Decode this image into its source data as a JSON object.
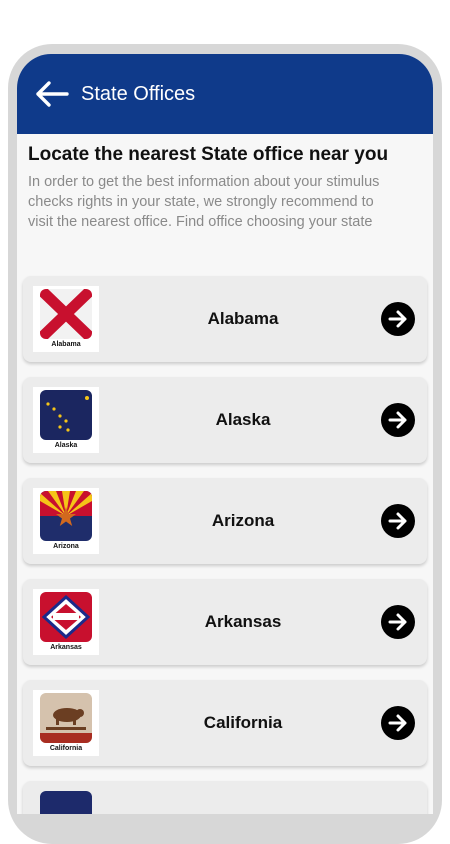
{
  "appbar": {
    "title": "State Offices",
    "back_icon": "arrow-left-icon"
  },
  "heading": "Locate the nearest State office near you",
  "description": "In order to get the best information about your stimulus checks rights in your state, we strongly recommend to visit the nearest  office. Find office choosing your state",
  "states": [
    {
      "name": "Alabama",
      "caption": "Alabama"
    },
    {
      "name": "Alaska",
      "caption": "Alaska"
    },
    {
      "name": "Arizona",
      "caption": "Arizona"
    },
    {
      "name": "Arkansas",
      "caption": "Arkansas"
    },
    {
      "name": "California",
      "caption": "California"
    }
  ],
  "colors": {
    "appbar": "#0f3a8a",
    "card": "#ececec",
    "background": "#f7f7f7"
  }
}
